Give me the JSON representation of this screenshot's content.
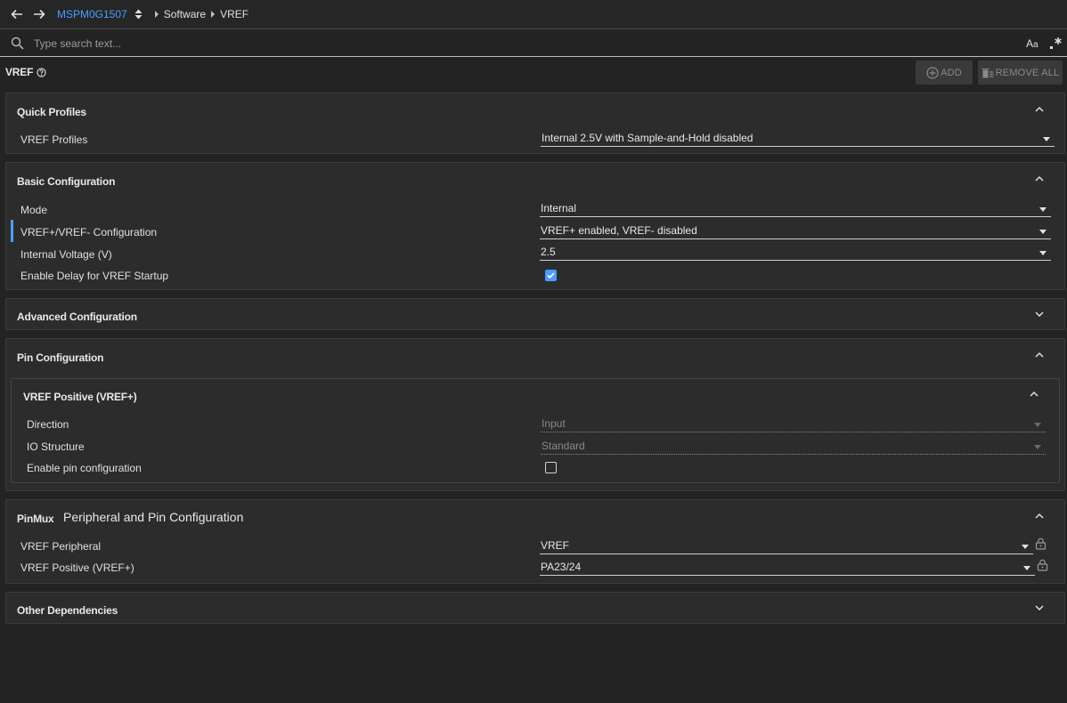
{
  "breadcrumb": {
    "device": "MSPM0G1507",
    "items": [
      "Software",
      "VREF"
    ]
  },
  "search": {
    "placeholder": "Type search text...",
    "case_label_big": "A",
    "case_label_small": "a"
  },
  "page": {
    "title": "VREF",
    "add_label": "ADD",
    "remove_all_label": "REMOVE ALL"
  },
  "quick_profiles": {
    "title": "Quick Profiles",
    "rows": [
      {
        "label": "VREF Profiles",
        "value": "Internal 2.5V with Sample-and-Hold disabled"
      }
    ]
  },
  "basic_configuration": {
    "title": "Basic Configuration",
    "rows": [
      {
        "label": "Mode",
        "value": "Internal"
      },
      {
        "label": "VREF+/VREF- Configuration",
        "value": "VREF+ enabled, VREF- disabled"
      },
      {
        "label": "Internal Voltage (V)",
        "value": "2.5"
      },
      {
        "label": "Enable Delay for VREF Startup",
        "checked": true
      }
    ]
  },
  "advanced_configuration": {
    "title": "Advanced Configuration"
  },
  "pin_configuration": {
    "title": "Pin Configuration",
    "subsection": {
      "title": "VREF Positive (VREF+)",
      "rows": [
        {
          "label": "Direction",
          "value": "Input"
        },
        {
          "label": "IO Structure",
          "value": "Standard"
        },
        {
          "label": "Enable pin configuration",
          "checked": false
        }
      ]
    }
  },
  "pinmux": {
    "title": "PinMux",
    "subtitle": "Peripheral and Pin Configuration",
    "rows": [
      {
        "label": "VREF Peripheral",
        "value": "VREF"
      },
      {
        "label": "VREF Positive (VREF+)",
        "value": "PA23/24"
      }
    ]
  },
  "other_dependencies": {
    "title": "Other Dependencies"
  },
  "colors": {
    "accent": "#4a9eff",
    "background": "#232323",
    "panel": "#2c2c2c"
  },
  "icons": [
    "arrow-left-icon",
    "arrow-right-icon",
    "up-down-icon",
    "search-icon",
    "match-case-icon",
    "regex-icon",
    "help-icon",
    "add-circle-icon",
    "remove-all-icon",
    "chevron-up-icon",
    "chevron-down-icon",
    "lock-icon",
    "checkmark-icon"
  ]
}
